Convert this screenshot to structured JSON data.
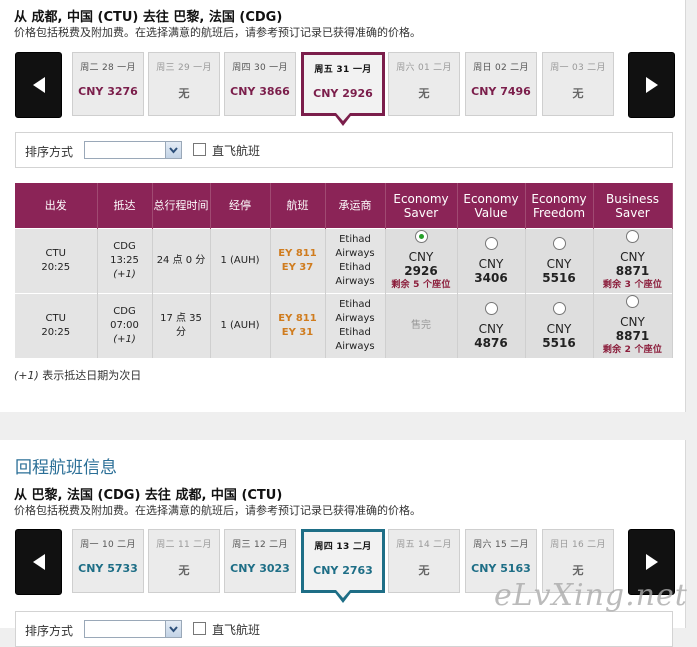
{
  "outbound": {
    "route": "从 成都, 中国 (CTU) 去往 巴黎, 法国 (CDG)",
    "note": "价格包括税费及附加费。在选择满意的航班后，请参考预订记录已获得准确的价格。",
    "dates": [
      {
        "label": "周二 28 一月",
        "price": "CNY 3276",
        "state": "normal"
      },
      {
        "label": "周三 29 一月",
        "price": "无",
        "state": "none"
      },
      {
        "label": "周四 30 一月",
        "price": "CNY 3866",
        "state": "normal"
      },
      {
        "label": "周五 31 一月",
        "price": "CNY 2926",
        "state": "selected"
      },
      {
        "label": "周六 01 二月",
        "price": "无",
        "state": "none"
      },
      {
        "label": "周日 02 二月",
        "price": "CNY 7496",
        "state": "normal"
      },
      {
        "label": "周一 03 二月",
        "price": "无",
        "state": "none"
      }
    ],
    "sort_label": "排序方式",
    "direct_label": "直飞航班",
    "columns": [
      "出发",
      "抵达",
      "总行程时间",
      "经停",
      "航班",
      "承运商",
      "Economy Saver",
      "Economy Value",
      "Economy Freedom",
      "Business Saver"
    ],
    "flights": [
      {
        "dep_airport": "CTU",
        "dep_time": "20:25",
        "arr_airport": "CDG",
        "arr_time": "13:25",
        "arr_next": "(+1)",
        "duration": "24 点 0 分",
        "stops": "1 (AUH)",
        "flight1": "EY 811",
        "flight2": "EY 37",
        "carrier": [
          "Etihad",
          "Airways",
          "Etihad",
          "Airways"
        ],
        "fares": [
          {
            "cur": "CNY",
            "amt": "2926",
            "seats": "剩余 5 个座位",
            "selected": true,
            "avail": true
          },
          {
            "cur": "CNY",
            "amt": "3406",
            "seats": "",
            "selected": false,
            "avail": true
          },
          {
            "cur": "CNY",
            "amt": "5516",
            "seats": "",
            "selected": false,
            "avail": true
          },
          {
            "cur": "CNY",
            "amt": "8871",
            "seats": "剩余 3 个座位",
            "selected": false,
            "avail": true
          }
        ]
      },
      {
        "dep_airport": "CTU",
        "dep_time": "20:25",
        "arr_airport": "CDG",
        "arr_time": "07:00",
        "arr_next": "(+1)",
        "duration": "17 点 35 分",
        "stops": "1 (AUH)",
        "flight1": "EY 811",
        "flight2": "EY 31",
        "carrier": [
          "Etihad",
          "Airways",
          "Etihad",
          "Airways"
        ],
        "fares": [
          {
            "cur": "",
            "amt": "售完",
            "seats": "",
            "selected": false,
            "avail": false
          },
          {
            "cur": "CNY",
            "amt": "4876",
            "seats": "",
            "selected": false,
            "avail": true
          },
          {
            "cur": "CNY",
            "amt": "5516",
            "seats": "",
            "selected": false,
            "avail": true
          },
          {
            "cur": "CNY",
            "amt": "8871",
            "seats": "剩余 2 个座位",
            "selected": false,
            "avail": true
          }
        ]
      }
    ],
    "footnote_mark": "(+1)",
    "footnote_text": " 表示抵达日期为次日"
  },
  "return": {
    "title": "回程航班信息",
    "route": "从 巴黎, 法国 (CDG) 去往 成都, 中国 (CTU)",
    "note": "价格包括税费及附加费。在选择满意的航班后，请参考预订记录已获得准确的价格。",
    "dates": [
      {
        "label": "周一 10 二月",
        "price": "CNY 5733",
        "state": "normal"
      },
      {
        "label": "周二 11 二月",
        "price": "无",
        "state": "none"
      },
      {
        "label": "周三 12 二月",
        "price": "CNY 3023",
        "state": "normal"
      },
      {
        "label": "周四 13 二月",
        "price": "CNY 2763",
        "state": "selected"
      },
      {
        "label": "周五 14 二月",
        "price": "无",
        "state": "none"
      },
      {
        "label": "周六 15 二月",
        "price": "CNY 5163",
        "state": "normal"
      },
      {
        "label": "周日 16 二月",
        "price": "无",
        "state": "none"
      }
    ],
    "sort_label": "排序方式",
    "direct_label": "直飞航班"
  },
  "watermark": "eLvXing.net",
  "colors": {
    "outbound_accent": "#7b1e4b",
    "return_accent": "#1e6e86",
    "header_bg": "#8b2457",
    "flight_number": "#d07c1e",
    "seat_warning": "#8b1d3b",
    "return_title": "#2b6f97"
  }
}
